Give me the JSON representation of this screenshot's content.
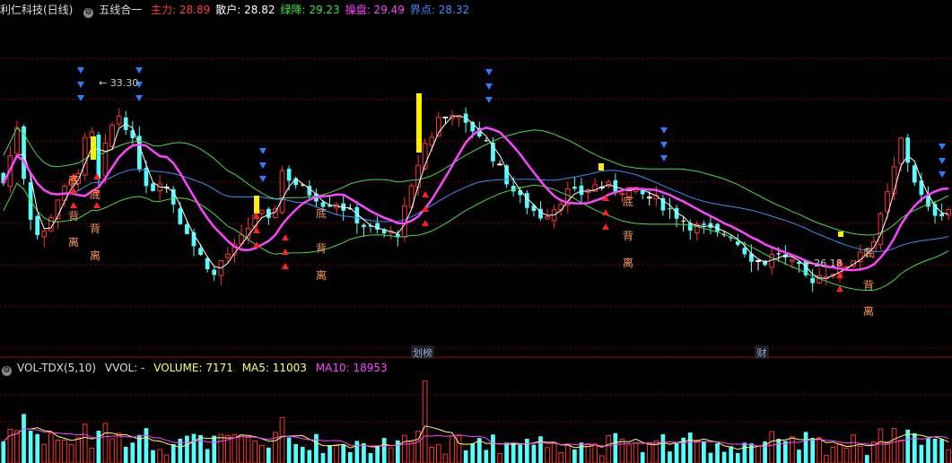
{
  "main_header": {
    "stock": "利仁科技(日线)",
    "indicator": "五线合一",
    "items": [
      {
        "label": "主力:",
        "value": "28.89",
        "color": "#ff3b3b"
      },
      {
        "label": "散户:",
        "value": "28.82",
        "color": "#ffffff"
      },
      {
        "label": "绿降:",
        "value": "29.23",
        "color": "#32e632"
      },
      {
        "label": "操盘:",
        "value": "29.49",
        "color": "#ff40ff"
      },
      {
        "label": "界点:",
        "value": "28.32",
        "color": "#3c8cff"
      }
    ]
  },
  "vol_header": {
    "indicator": "VOL-TDX(5,10)",
    "vvol": "VVOL: -",
    "volume": "VOLUME: 7171",
    "ma5": "MA5: 11003",
    "ma10": "MA10: 18953"
  },
  "markers": {
    "high_label": "33.30",
    "low_label": "26.18",
    "div_chars": [
      "底",
      "背",
      "离"
    ],
    "event_1": "划榜",
    "event_2": "财"
  },
  "colors": {
    "up": "#ff3232",
    "down": "#54ffff",
    "flat": "#ffffff",
    "grid": "#8b0000",
    "ma_white": "#ffffff",
    "ma_magenta": "#ff44ff",
    "ma_blue": "#3c8cff",
    "band_green": "#44dd44",
    "div_text": "#ff9955"
  },
  "chart_data": {
    "type": "candlestick",
    "ylim_price": [
      24.0,
      34.8
    ],
    "ylim_volume": [
      0,
      40000
    ],
    "bars": 140
  }
}
